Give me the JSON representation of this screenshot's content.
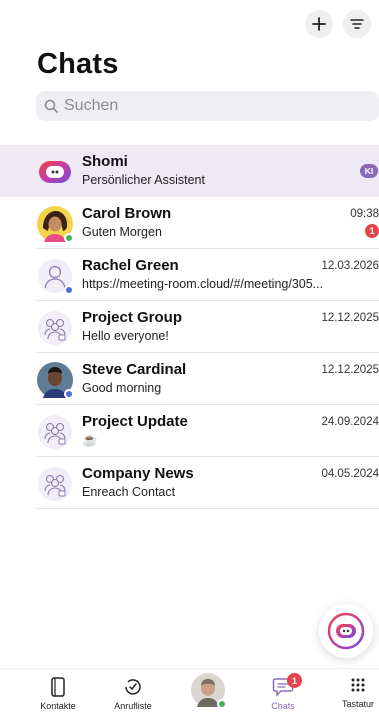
{
  "header": {
    "title": "Chats"
  },
  "search": {
    "placeholder": "Suchen"
  },
  "chats": [
    {
      "name": "Shomi",
      "preview": "Persönlicher Assistent",
      "time": "",
      "badge": "KI",
      "avatar": "assistant-logo"
    },
    {
      "name": "Carol Brown",
      "preview": "Guten Morgen",
      "time": "09:38",
      "unread": "1",
      "avatar": "photo",
      "presence": "#3fb35a"
    },
    {
      "name": "Rachel Green",
      "preview": "https://meeting-room.cloud/#/meeting/305...",
      "time": "12.03.2026",
      "avatar": "person-outline",
      "presence": "#4b6fd6"
    },
    {
      "name": "Project Group",
      "preview": "Hello everyone!",
      "time": "12.12.2025",
      "avatar": "group-outline"
    },
    {
      "name": "Steve Cardinal",
      "preview": "Good morning",
      "time": "12.12.2025",
      "avatar": "photo",
      "presence": "#4b6fd6"
    },
    {
      "name": "Project Update",
      "preview": "☕",
      "time": "24.09.2024",
      "avatar": "group-outline"
    },
    {
      "name": "Company News",
      "preview": "Enreach Contact",
      "time": "04.05.2024",
      "avatar": "group-outline"
    }
  ],
  "tabs": [
    {
      "label": "Kontakte",
      "icon": "phone-book-icon"
    },
    {
      "label": "Anrufliste",
      "icon": "call-history-icon"
    },
    {
      "label": "",
      "icon": "profile-avatar"
    },
    {
      "label": "Chats",
      "icon": "chat-bubble-icon",
      "badge": "1",
      "active": true
    },
    {
      "label": "Tastatur",
      "icon": "dialpad-icon"
    }
  ],
  "colors": {
    "accent": "#8a6bb8",
    "highlight": "#efe9f6",
    "unread": "#e5454a"
  }
}
